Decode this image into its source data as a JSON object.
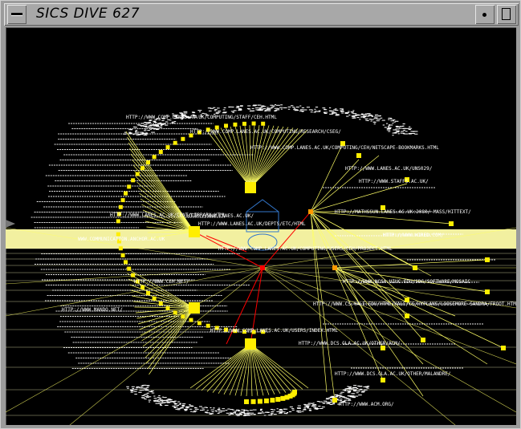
{
  "window": {
    "title": "SICS DIVE 627"
  },
  "colors": {
    "background": "#000000",
    "node": "#ffee00",
    "link": "#ffff66",
    "cross_link": "#ff0000",
    "ground": "#f2f0a0",
    "focus": "#3377cc",
    "hub": "#ff9900"
  },
  "scene": {
    "labels": [
      "HTTP://WWW.LANES.AC.UK/",
      "HTTP://WWW.STAFFS.AC.UK/",
      "HTTP://WWW.LANES.AC.UK/UNS029/",
      "HTTP://WWW.DCS.GLA.AC.UK/OTHER/MALANDRE/",
      "HTTP://WWW.COMP.LANES.AC.UK/COMPUTING/STAFF/CEH.HTML",
      "HTTP://WWW.COMP.LANES.AC.UK/COMPUTING/RESEARCH/CSEG/",
      "HTTP://WWW.COMP.LANES.AC.UK/COMPUTING/CEH/NETSCAPE-BOOKMARKS.HTML",
      "HTTP://WWW.COMP.LANES.AC.UK/COMPUTING/USERS/CEH/PROJECT.HTML",
      "HTTP://WWW.COMP.LANES.AC.UK/USERS/INDEX.HTML",
      "HTTP://WWW.LANES.AC.UK/DEPTS/ETC/HTML",
      "HTTP://WWW.LANES.AC.UK/CENT/LIBRARY.HTML",
      "HTTP://WWW.NCSA.UIUC.EDU/SDG/SOFTWARE/MOSAIC",
      "HTTP://WWW.CS.YALE.EDU/HTML/YALE/CS/HYPLANS/LOOSEMORE-SANDRA/FROOT.HTML",
      "HTTP://MATHSSUN.LANES.AC.UK:2080/~MASS/HITTEXT/",
      "HTTP://WWW.WIRED.COM/",
      "HTTP://WWW.DCS.GLA.AC.UK/OTHER/ACM/",
      "HTTP://WWW.ACM.ORG/",
      "HTTP://WWW.CEH.NET/",
      "HTTP://WWW.MANDO.NET/",
      "WWW.COMMUNICATION.ANCHOR.AC.UK"
    ]
  }
}
